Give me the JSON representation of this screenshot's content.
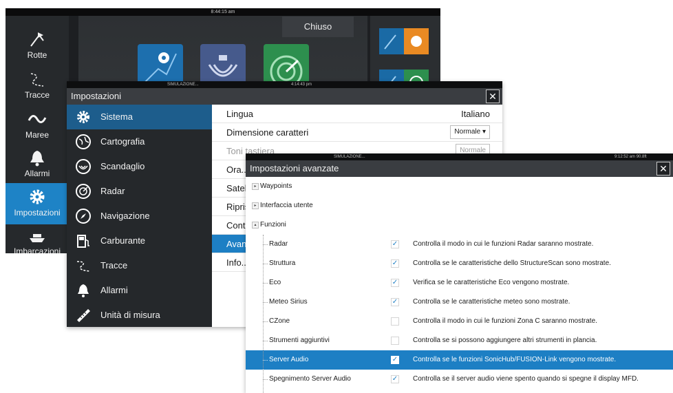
{
  "home": {
    "clock": "8:44:15 am",
    "close_label": "Chiuso",
    "sidebar": [
      {
        "label": "Rotte",
        "icon": "routes-icon"
      },
      {
        "label": "Tracce",
        "icon": "trails-icon"
      },
      {
        "label": "Maree",
        "icon": "tides-icon"
      },
      {
        "label": "Allarmi",
        "icon": "alarm-bell-icon"
      },
      {
        "label": "Impostazioni",
        "icon": "gear-icon",
        "active": true
      },
      {
        "label": "Imbarcazioni",
        "icon": "vessels-icon"
      }
    ]
  },
  "settings": {
    "sim": "SIMULAZIONE...",
    "clock": "4:14:43 pm",
    "title": "Impostazioni",
    "close_glyph": "✕",
    "menu": [
      {
        "label": "Sistema",
        "icon": "gear-icon",
        "selected": true
      },
      {
        "label": "Cartografia",
        "icon": "chart-icon"
      },
      {
        "label": "Scandaglio",
        "icon": "sonar-icon"
      },
      {
        "label": "Radar",
        "icon": "radar-icon"
      },
      {
        "label": "Navigazione",
        "icon": "compass-icon"
      },
      {
        "label": "Carburante",
        "icon": "fuel-icon"
      },
      {
        "label": "Tracce",
        "icon": "trails-icon"
      },
      {
        "label": "Allarmi",
        "icon": "alarm-bell-icon"
      },
      {
        "label": "Unità di misura",
        "icon": "ruler-icon"
      }
    ],
    "rows": [
      {
        "label": "Lingua",
        "value": "Italiano"
      },
      {
        "label": "Dimensione caratteri",
        "dropdown": "Normale ▾"
      },
      {
        "label": "Toni tastiera",
        "dropdown": "Normale"
      },
      {
        "label": "Ora..."
      },
      {
        "label": "Satelliti"
      },
      {
        "label": "Ripristina"
      },
      {
        "label": "Contr..."
      },
      {
        "label": "Avanzate",
        "selected": true
      },
      {
        "label": "Info..."
      }
    ]
  },
  "advanced": {
    "sim": "SIMULAZIONE...",
    "clock": "9:12:52 am  90.8ft",
    "title": "Impostazioni avanzate",
    "close_glyph": "✕",
    "groups": [
      {
        "label": "Waypoints",
        "expander": "▸"
      },
      {
        "label": "Interfaccia utente",
        "expander": "▸"
      },
      {
        "label": "Funzioni",
        "expander": "▴"
      }
    ],
    "features": [
      {
        "label": "Radar",
        "checked": true,
        "desc": "Controlla il modo in cui le funzioni Radar saranno mostrate."
      },
      {
        "label": "Struttura",
        "checked": true,
        "desc": "Controlla se le caratteristiche dello StructureScan sono mostrate."
      },
      {
        "label": "Eco",
        "checked": true,
        "desc": "Verifica se le caratteristiche Eco vengono mostrate."
      },
      {
        "label": "Meteo Sirius",
        "checked": true,
        "desc": "Controlla se le caratteristiche meteo sono mostrate."
      },
      {
        "label": "CZone",
        "checked": false,
        "desc": "Controlla il modo in cui le funzioni Zona C saranno mostrate."
      },
      {
        "label": "Strumenti aggiuntivi",
        "checked": false,
        "desc": "Controlla se si possono aggiungere altri strumenti in plancia."
      },
      {
        "label": "Server Audio",
        "checked": true,
        "selected": true,
        "desc": "Controlla se le funzioni SonicHub/FUSION-Link vengono mostrate."
      },
      {
        "label": "Spegnimento Server Audio",
        "checked": true,
        "desc": "Controlla se il server audio viene spento quando si spegne il display MFD."
      }
    ],
    "check_glyph": "✓"
  }
}
